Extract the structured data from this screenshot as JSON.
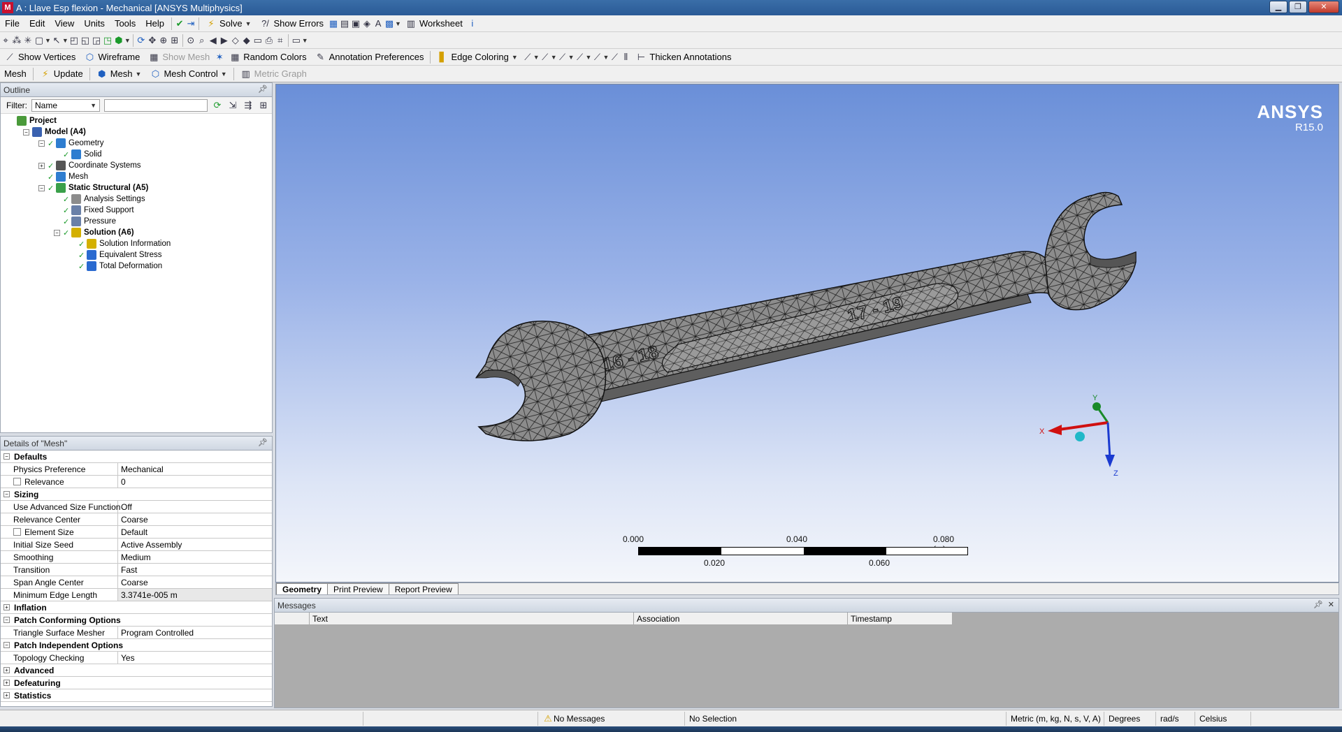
{
  "window": {
    "title": "A : Llave Esp flexion - Mechanical [ANSYS Multiphysics]",
    "app_icon": "M"
  },
  "menu": [
    "File",
    "Edit",
    "View",
    "Units",
    "Tools",
    "Help"
  ],
  "toolbar1": {
    "solve": "Solve",
    "show_errors": "Show Errors",
    "worksheet": "Worksheet"
  },
  "toolbar3": {
    "show_vertices": "Show Vertices",
    "wireframe": "Wireframe",
    "show_mesh": "Show Mesh",
    "random_colors": "Random Colors",
    "annotation_prefs": "Annotation Preferences",
    "edge_coloring": "Edge Coloring",
    "thicken_annotations": "Thicken Annotations"
  },
  "toolbar4": {
    "mesh_label": "Mesh",
    "update": "Update",
    "mesh_dd": "Mesh",
    "mesh_control": "Mesh Control",
    "metric_graph": "Metric Graph"
  },
  "outline": {
    "title": "Outline",
    "filter_label": "Filter:",
    "filter_value": "Name",
    "tree": [
      {
        "label": "Project",
        "bold": true,
        "indent": 0,
        "exp": "",
        "icon": "proj",
        "check": ""
      },
      {
        "label": "Model (A4)",
        "bold": true,
        "indent": 1,
        "exp": "−",
        "icon": "model",
        "check": ""
      },
      {
        "label": "Geometry",
        "bold": false,
        "indent": 2,
        "exp": "−",
        "icon": "geo",
        "check": "✓"
      },
      {
        "label": "Solid",
        "bold": false,
        "indent": 3,
        "exp": "",
        "icon": "geo",
        "check": "✓"
      },
      {
        "label": "Coordinate Systems",
        "bold": false,
        "indent": 2,
        "exp": "+",
        "icon": "cs",
        "check": "✓"
      },
      {
        "label": "Mesh",
        "bold": false,
        "indent": 2,
        "exp": "",
        "icon": "geo",
        "check": "✓"
      },
      {
        "label": "Static Structural (A5)",
        "bold": true,
        "indent": 2,
        "exp": "−",
        "icon": "stat",
        "check": "✓"
      },
      {
        "label": "Analysis Settings",
        "bold": false,
        "indent": 3,
        "exp": "",
        "icon": "set",
        "check": "✓"
      },
      {
        "label": "Fixed Support",
        "bold": false,
        "indent": 3,
        "exp": "",
        "icon": "sup",
        "check": "✓"
      },
      {
        "label": "Pressure",
        "bold": false,
        "indent": 3,
        "exp": "",
        "icon": "sup",
        "check": "✓"
      },
      {
        "label": "Solution (A6)",
        "bold": true,
        "indent": 3,
        "exp": "−",
        "icon": "sol",
        "check": "✓"
      },
      {
        "label": "Solution Information",
        "bold": false,
        "indent": 4,
        "exp": "",
        "icon": "sol",
        "check": "✓"
      },
      {
        "label": "Equivalent Stress",
        "bold": false,
        "indent": 4,
        "exp": "",
        "icon": "res",
        "check": "✓"
      },
      {
        "label": "Total Deformation",
        "bold": false,
        "indent": 4,
        "exp": "",
        "icon": "res",
        "check": "✓"
      }
    ]
  },
  "details": {
    "title": "Details of \"Mesh\"",
    "rows": [
      {
        "type": "group",
        "label": "Defaults",
        "exp": "−"
      },
      {
        "type": "prop",
        "key": "Physics Preference",
        "value": "Mechanical",
        "cb": false
      },
      {
        "type": "prop",
        "key": "Relevance",
        "value": "0",
        "cb": true
      },
      {
        "type": "group",
        "label": "Sizing",
        "exp": "−"
      },
      {
        "type": "prop",
        "key": "Use Advanced Size Function",
        "value": "Off",
        "cb": false
      },
      {
        "type": "prop",
        "key": "Relevance Center",
        "value": "Coarse",
        "cb": false
      },
      {
        "type": "prop",
        "key": "Element Size",
        "value": "Default",
        "cb": true
      },
      {
        "type": "prop",
        "key": "Initial Size Seed",
        "value": "Active Assembly",
        "cb": false
      },
      {
        "type": "prop",
        "key": "Smoothing",
        "value": "Medium",
        "cb": false
      },
      {
        "type": "prop",
        "key": "Transition",
        "value": "Fast",
        "cb": false
      },
      {
        "type": "prop",
        "key": "Span Angle Center",
        "value": "Coarse",
        "cb": false
      },
      {
        "type": "prop",
        "key": "Minimum Edge Length",
        "value": "3.3741e-005 m",
        "cb": false,
        "hl": true
      },
      {
        "type": "group",
        "label": "Inflation",
        "exp": "+"
      },
      {
        "type": "group",
        "label": "Patch Conforming Options",
        "exp": "−"
      },
      {
        "type": "prop",
        "key": "Triangle Surface Mesher",
        "value": "Program Controlled",
        "cb": false
      },
      {
        "type": "group",
        "label": "Patch Independent Options",
        "exp": "−"
      },
      {
        "type": "prop",
        "key": "Topology Checking",
        "value": "Yes",
        "cb": false
      },
      {
        "type": "group",
        "label": "Advanced",
        "exp": "+"
      },
      {
        "type": "group",
        "label": "Defeaturing",
        "exp": "+"
      },
      {
        "type": "group",
        "label": "Statistics",
        "exp": "+"
      }
    ]
  },
  "viewport": {
    "brand": "ANSYS",
    "version": "R15.0",
    "wrench_text_left": "16 - 18",
    "wrench_text_right": "17 - 19",
    "scale_top": [
      "0.000",
      "0.040",
      "0.080 (m)"
    ],
    "scale_bottom": [
      "0.020",
      "0.060"
    ],
    "axes": {
      "x": "X",
      "y": "Y",
      "z": "Z"
    },
    "axis_colors": {
      "x": "#d01010",
      "y": "#1a8a2a",
      "z": "#1a3ad0"
    }
  },
  "view_tabs": [
    "Geometry",
    "Print Preview",
    "Report Preview"
  ],
  "messages": {
    "title": "Messages",
    "columns": [
      "Text",
      "Association",
      "Timestamp"
    ]
  },
  "statusbar": {
    "messages": "No Messages",
    "selection": "No Selection",
    "units": "Metric (m, kg, N, s, V, A)",
    "angle": "Degrees",
    "rate": "rad/s",
    "temp": "Celsius"
  }
}
